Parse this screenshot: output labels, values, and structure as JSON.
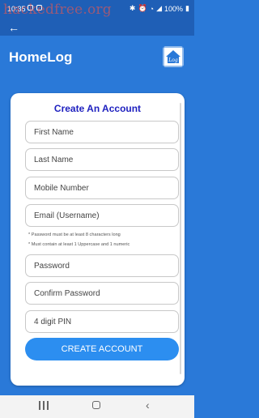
{
  "status_bar": {
    "time": "10:35",
    "battery": "100%"
  },
  "watermark": "hackedfree.org",
  "header": {
    "back_icon": "arrow-left-icon",
    "title": "HomeLog",
    "logo_text": "Log"
  },
  "form": {
    "title": "Create An Account",
    "fields": {
      "first_name": "First Name",
      "last_name": "Last Name",
      "mobile": "Mobile Number",
      "email": "Email (Username)",
      "password": "Password",
      "confirm_password": "Confirm Password",
      "pin": "4 digit PIN"
    },
    "notes": [
      "* Password must be at least 8 characters long",
      "* Must contain at least 1 Uppercase and 1 numeric"
    ],
    "submit_label": "CREATE ACCOUNT"
  },
  "colors": {
    "accent": "#2a79d8",
    "title": "#1d1fbf",
    "button": "#2c8ef0"
  }
}
